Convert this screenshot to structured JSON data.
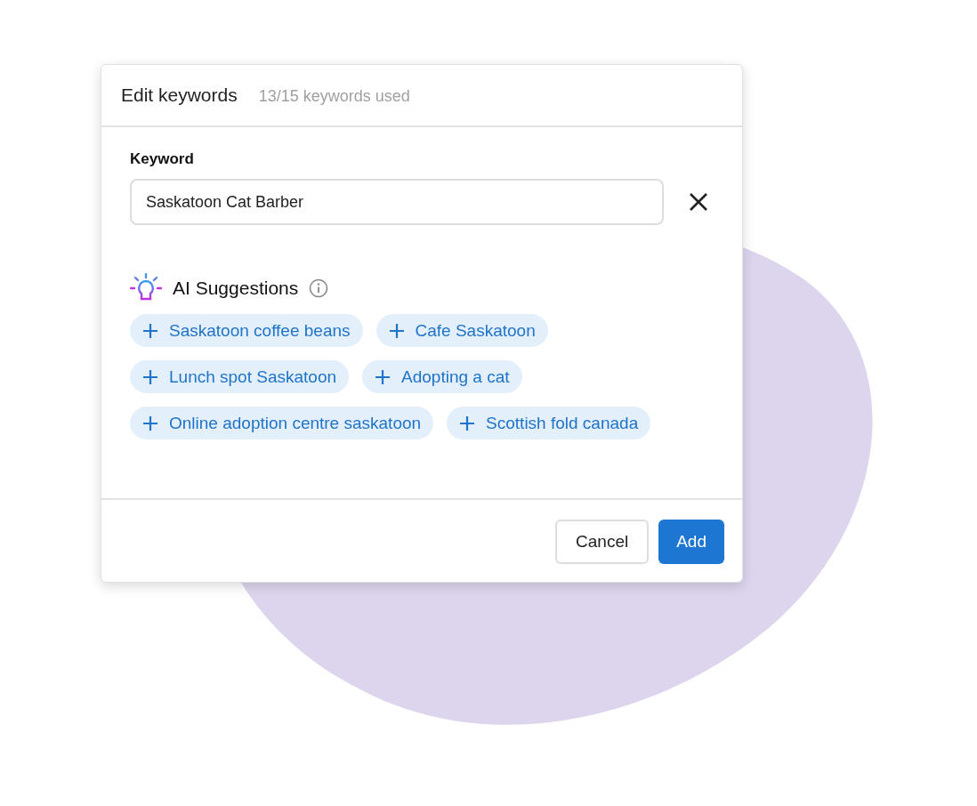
{
  "dialog": {
    "title": "Edit keywords",
    "usage": "13/15 keywords used"
  },
  "keyword": {
    "label": "Keyword",
    "value": "Saskatoon Cat Barber"
  },
  "suggestions": {
    "title": "AI Suggestions",
    "items": [
      {
        "label": "Saskatoon coffee beans"
      },
      {
        "label": "Cafe Saskatoon"
      },
      {
        "label": "Lunch spot Saskatoon"
      },
      {
        "label": "Adopting a cat"
      },
      {
        "label": "Online adoption centre saskatoon"
      },
      {
        "label": "Scottish fold canada"
      }
    ]
  },
  "buttons": [
    {
      "label": "Cancel",
      "kind": "secondary"
    },
    {
      "label": "Add",
      "kind": "primary"
    }
  ]
}
